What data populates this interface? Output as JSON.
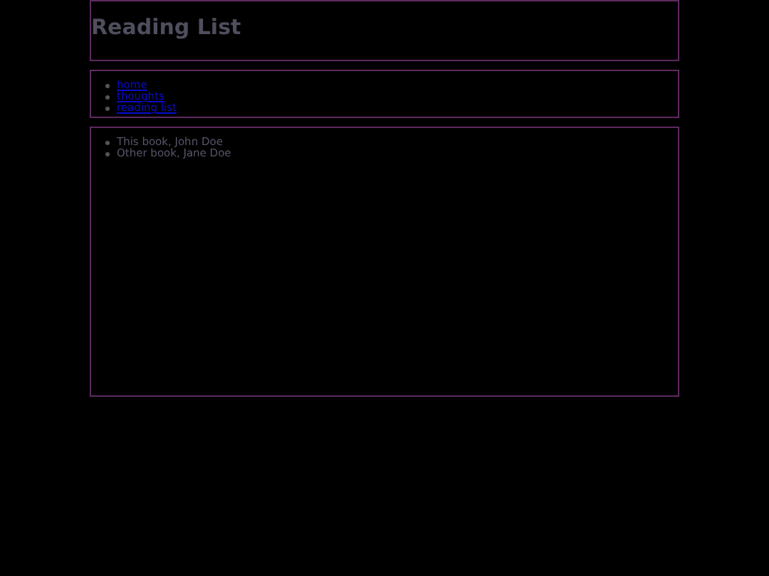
{
  "header": {
    "title": "Reading List"
  },
  "nav": {
    "links": [
      "home",
      "thoughts",
      "reading list"
    ]
  },
  "books": [
    "This book, John Doe",
    "Other book, Jane Doe"
  ]
}
